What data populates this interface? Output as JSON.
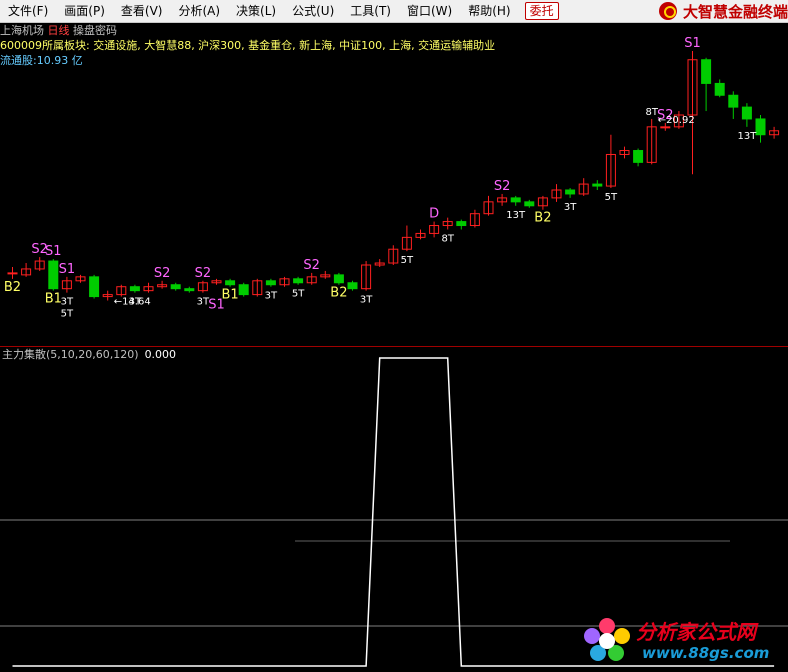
{
  "menu": [
    "文件(F)",
    "画面(P)",
    "查看(V)",
    "分析(A)",
    "决策(L)",
    "公式(U)",
    "工具(T)",
    "窗口(W)",
    "帮助(H)"
  ],
  "weituo_label": "委托",
  "brand_title": "大智慧金融终端",
  "stock": {
    "name": "上海机场",
    "period": "日线",
    "mode": "操盘密码",
    "sector_label": "600009所属板块:",
    "sectors": "交通设施, 大智慧88, 沪深300, 基金重仓, 新上海, 中证100, 上海, 交通运输辅助业",
    "float_label": "流通股:",
    "float_value": "10.93",
    "float_unit": "亿"
  },
  "indicator": {
    "name": "主力集散",
    "params": "(5,10,20,60,120)",
    "value": "0.000"
  },
  "watermark": {
    "title": "分析家公式网",
    "url": "www.88gs.com"
  },
  "colors": {
    "up": "#ff2020",
    "down": "#00cc00",
    "signal_s": "#ff66ff",
    "signal_b": "#ffff66",
    "signal_t": "#ffffff",
    "grid": "#808080"
  },
  "chart_data": {
    "type": "candlestick",
    "price_range": [
      13.6,
      21.2
    ],
    "candles": [
      {
        "o": 15.3,
        "c": 15.3,
        "h": 15.45,
        "l": 15.15
      },
      {
        "o": 15.25,
        "c": 15.4,
        "h": 15.55,
        "l": 15.2
      },
      {
        "o": 15.4,
        "c": 15.6,
        "h": 15.7,
        "l": 15.35
      },
      {
        "o": 15.6,
        "c": 14.9,
        "h": 15.65,
        "l": 14.85
      },
      {
        "o": 14.9,
        "c": 15.1,
        "h": 15.2,
        "l": 14.8
      },
      {
        "o": 15.1,
        "c": 15.2,
        "h": 15.25,
        "l": 15.05
      },
      {
        "o": 15.2,
        "c": 14.7,
        "h": 15.25,
        "l": 14.65
      },
      {
        "o": 14.7,
        "c": 14.75,
        "h": 14.85,
        "l": 14.6
      },
      {
        "o": 14.75,
        "c": 14.95,
        "h": 15.0,
        "l": 14.7
      },
      {
        "o": 14.95,
        "c": 14.85,
        "h": 15.0,
        "l": 14.8
      },
      {
        "o": 14.85,
        "c": 14.95,
        "h": 15.05,
        "l": 14.8
      },
      {
        "o": 14.95,
        "c": 15.0,
        "h": 15.1,
        "l": 14.9
      },
      {
        "o": 15.0,
        "c": 14.9,
        "h": 15.05,
        "l": 14.85
      },
      {
        "o": 14.9,
        "c": 14.85,
        "h": 14.95,
        "l": 14.8
      },
      {
        "o": 14.85,
        "c": 15.05,
        "h": 15.1,
        "l": 14.8
      },
      {
        "o": 15.05,
        "c": 15.1,
        "h": 15.15,
        "l": 15.0
      },
      {
        "o": 15.1,
        "c": 15.0,
        "h": 15.15,
        "l": 14.95
      },
      {
        "o": 15.0,
        "c": 14.75,
        "h": 15.05,
        "l": 14.7
      },
      {
        "o": 14.75,
        "c": 15.1,
        "h": 15.15,
        "l": 14.7
      },
      {
        "o": 15.1,
        "c": 15.0,
        "h": 15.15,
        "l": 14.95
      },
      {
        "o": 15.0,
        "c": 15.15,
        "h": 15.2,
        "l": 14.95
      },
      {
        "o": 15.15,
        "c": 15.05,
        "h": 15.2,
        "l": 15.0
      },
      {
        "o": 15.05,
        "c": 15.2,
        "h": 15.3,
        "l": 15.0
      },
      {
        "o": 15.2,
        "c": 15.25,
        "h": 15.35,
        "l": 15.15
      },
      {
        "o": 15.25,
        "c": 15.05,
        "h": 15.3,
        "l": 15.0
      },
      {
        "o": 15.05,
        "c": 14.9,
        "h": 15.1,
        "l": 14.85
      },
      {
        "o": 14.9,
        "c": 15.5,
        "h": 15.6,
        "l": 14.85
      },
      {
        "o": 15.5,
        "c": 15.55,
        "h": 15.65,
        "l": 15.45
      },
      {
        "o": 15.55,
        "c": 15.9,
        "h": 16.0,
        "l": 15.5
      },
      {
        "o": 15.9,
        "c": 16.2,
        "h": 16.5,
        "l": 15.85
      },
      {
        "o": 16.2,
        "c": 16.3,
        "h": 16.4,
        "l": 16.15
      },
      {
        "o": 16.3,
        "c": 16.5,
        "h": 16.6,
        "l": 16.2
      },
      {
        "o": 16.5,
        "c": 16.6,
        "h": 16.7,
        "l": 16.4
      },
      {
        "o": 16.6,
        "c": 16.5,
        "h": 16.65,
        "l": 16.4
      },
      {
        "o": 16.5,
        "c": 16.8,
        "h": 16.9,
        "l": 16.45
      },
      {
        "o": 16.8,
        "c": 17.1,
        "h": 17.25,
        "l": 16.75
      },
      {
        "o": 17.1,
        "c": 17.2,
        "h": 17.3,
        "l": 17.0
      },
      {
        "o": 17.2,
        "c": 17.1,
        "h": 17.25,
        "l": 17.0
      },
      {
        "o": 17.1,
        "c": 17.0,
        "h": 17.15,
        "l": 16.95
      },
      {
        "o": 17.0,
        "c": 17.2,
        "h": 17.25,
        "l": 16.9
      },
      {
        "o": 17.2,
        "c": 17.4,
        "h": 17.55,
        "l": 17.1
      },
      {
        "o": 17.4,
        "c": 17.3,
        "h": 17.45,
        "l": 17.2
      },
      {
        "o": 17.3,
        "c": 17.55,
        "h": 17.7,
        "l": 17.25
      },
      {
        "o": 17.55,
        "c": 17.5,
        "h": 17.65,
        "l": 17.4
      },
      {
        "o": 17.5,
        "c": 18.3,
        "h": 18.8,
        "l": 17.45
      },
      {
        "o": 18.3,
        "c": 18.4,
        "h": 18.5,
        "l": 18.2
      },
      {
        "o": 18.4,
        "c": 18.1,
        "h": 18.45,
        "l": 18.0
      },
      {
        "o": 18.1,
        "c": 19.0,
        "h": 19.2,
        "l": 18.05
      },
      {
        "o": 19.0,
        "c": 19.0,
        "h": 19.1,
        "l": 18.9
      },
      {
        "o": 19.0,
        "c": 19.3,
        "h": 19.4,
        "l": 18.95
      },
      {
        "o": 19.3,
        "c": 20.7,
        "h": 20.92,
        "l": 17.8
      },
      {
        "o": 20.7,
        "c": 20.1,
        "h": 20.75,
        "l": 19.4
      },
      {
        "o": 20.1,
        "c": 19.8,
        "h": 20.2,
        "l": 19.75
      },
      {
        "o": 19.8,
        "c": 19.5,
        "h": 19.9,
        "l": 19.2
      },
      {
        "o": 19.5,
        "c": 19.2,
        "h": 19.6,
        "l": 19.0
      },
      {
        "o": 19.2,
        "c": 18.8,
        "h": 19.3,
        "l": 18.6
      },
      {
        "o": 18.8,
        "c": 18.9,
        "h": 19.0,
        "l": 18.7
      }
    ],
    "markers": [
      {
        "i": 2,
        "text": "S2",
        "kind": "s",
        "pos": "above"
      },
      {
        "i": 3,
        "text": "S1",
        "kind": "s",
        "pos": "above"
      },
      {
        "i": 4,
        "text": "S1",
        "kind": "s",
        "pos": "above"
      },
      {
        "i": 4,
        "text": "3T",
        "kind": "t",
        "pos": "below"
      },
      {
        "i": 4,
        "text": "5T",
        "kind": "t",
        "pos": "below2"
      },
      {
        "i": 0,
        "text": "B2",
        "kind": "b",
        "pos": "below"
      },
      {
        "i": 3,
        "text": "B1",
        "kind": "b",
        "pos": "below"
      },
      {
        "i": 9,
        "text": "3T",
        "kind": "t",
        "pos": "below"
      },
      {
        "i": 11,
        "text": "S2",
        "kind": "s",
        "pos": "above"
      },
      {
        "i": 14,
        "text": "S2",
        "kind": "s",
        "pos": "above"
      },
      {
        "i": 14,
        "text": "3T",
        "kind": "t",
        "pos": "below"
      },
      {
        "i": 15,
        "text": "S1",
        "kind": "s",
        "pos": "below2"
      },
      {
        "i": 16,
        "text": "B1",
        "kind": "b",
        "pos": "below"
      },
      {
        "i": 19,
        "text": "3T",
        "kind": "t",
        "pos": "below"
      },
      {
        "i": 21,
        "text": "5T",
        "kind": "t",
        "pos": "below"
      },
      {
        "i": 22,
        "text": "S2",
        "kind": "s",
        "pos": "above"
      },
      {
        "i": 24,
        "text": "B2",
        "kind": "b",
        "pos": "below"
      },
      {
        "i": 26,
        "text": "3T",
        "kind": "t",
        "pos": "below"
      },
      {
        "i": 29,
        "text": "5T",
        "kind": "t",
        "pos": "below"
      },
      {
        "i": 31,
        "text": "D",
        "kind": "s",
        "pos": "above"
      },
      {
        "i": 32,
        "text": "8T",
        "kind": "t",
        "pos": "below"
      },
      {
        "i": 36,
        "text": "S2",
        "kind": "s",
        "pos": "above"
      },
      {
        "i": 37,
        "text": "13T",
        "kind": "t",
        "pos": "below"
      },
      {
        "i": 39,
        "text": "B2",
        "kind": "b",
        "pos": "below"
      },
      {
        "i": 41,
        "text": "3T",
        "kind": "t",
        "pos": "below"
      },
      {
        "i": 44,
        "text": "5T",
        "kind": "t",
        "pos": "below"
      },
      {
        "i": 47,
        "text": "8T",
        "kind": "t",
        "pos": "above"
      },
      {
        "i": 48,
        "text": "S2",
        "kind": "s",
        "pos": "above"
      },
      {
        "i": 50,
        "text": "S1",
        "kind": "s",
        "pos": "above"
      },
      {
        "i": 54,
        "text": "13T",
        "kind": "t",
        "pos": "below"
      }
    ],
    "price_labels": [
      {
        "i": 7,
        "text": "14.64",
        "pos": "low"
      },
      {
        "i": 47,
        "text": "20.92",
        "pos": "high"
      }
    ],
    "indicator_series": [
      0,
      0,
      0,
      0,
      0,
      0,
      0,
      0,
      0,
      0,
      0,
      0,
      0,
      0,
      0,
      0,
      0,
      0,
      0,
      0,
      0,
      0,
      0,
      0,
      0,
      0,
      0,
      1,
      1,
      1,
      1,
      1,
      1,
      0,
      0,
      0,
      0,
      0,
      0,
      0,
      0,
      0,
      0,
      0,
      0,
      0,
      0,
      0,
      0,
      0,
      0,
      0,
      0,
      0,
      0,
      0,
      0
    ],
    "indicator_range": [
      0,
      1
    ]
  }
}
